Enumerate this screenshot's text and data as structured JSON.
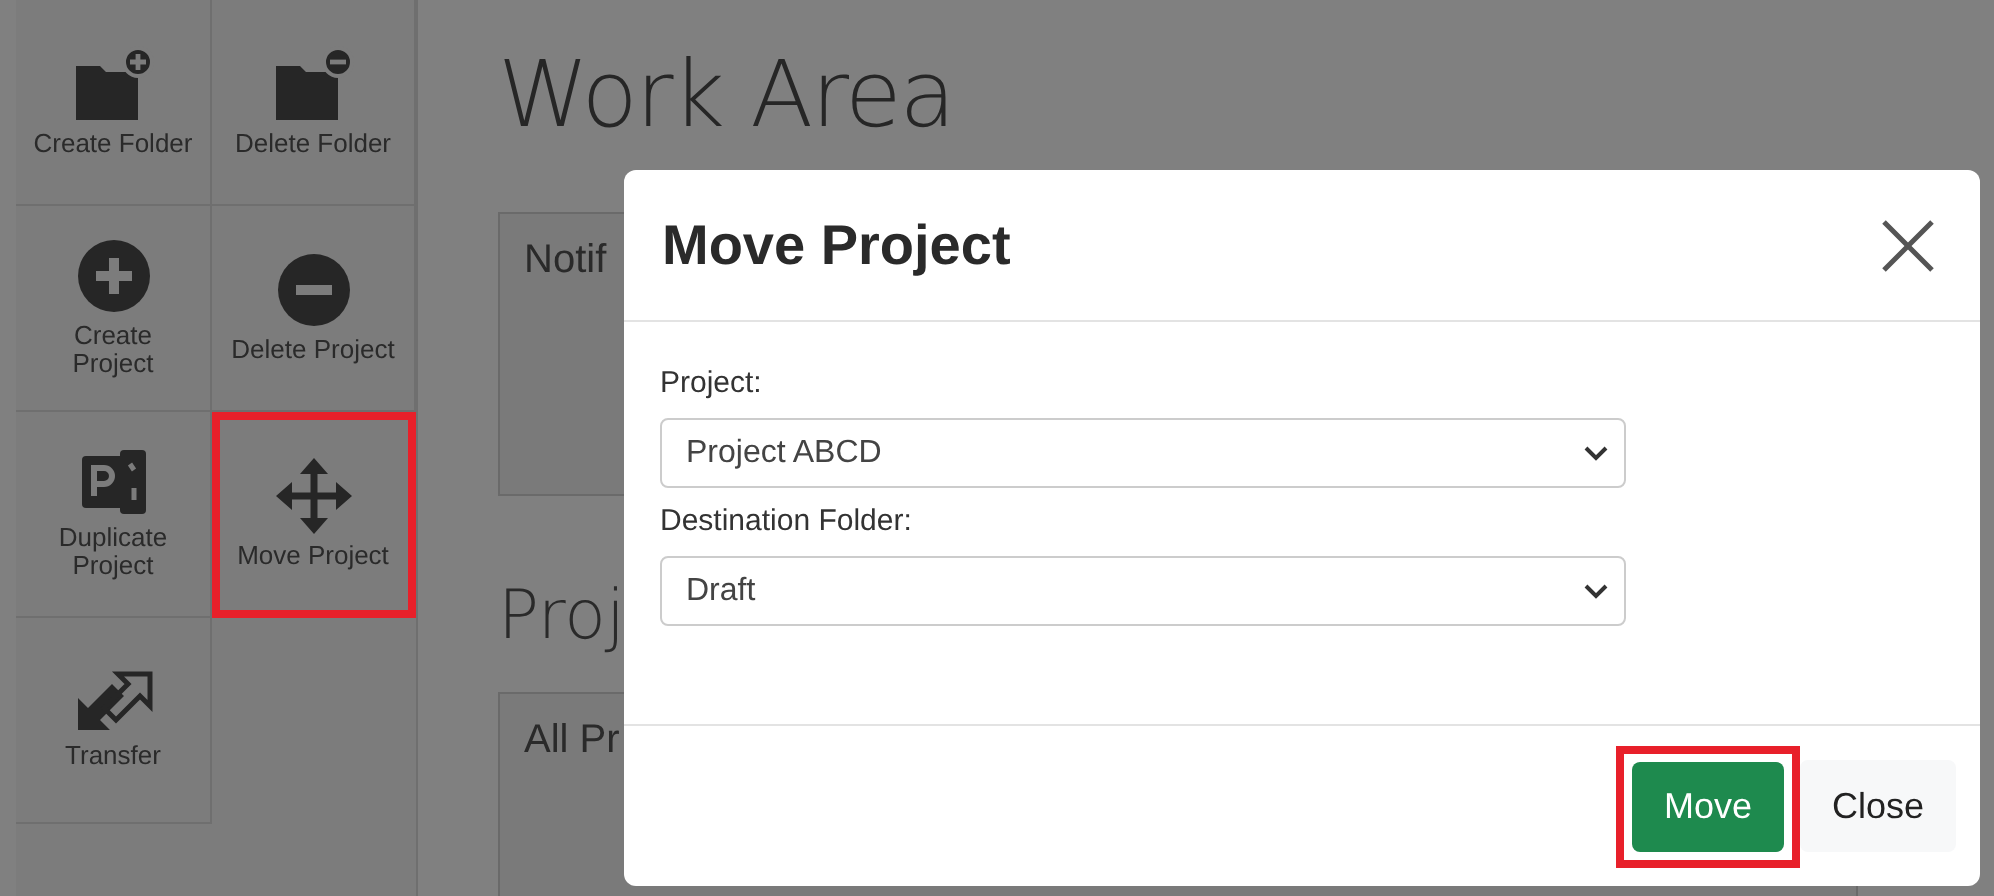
{
  "sidebar": {
    "items": [
      {
        "label": "Create Folder",
        "highlighted": false
      },
      {
        "label": "Delete Folder",
        "highlighted": false
      },
      {
        "label": "Create Project",
        "highlighted": false
      },
      {
        "label": "Delete Project",
        "highlighted": false
      },
      {
        "label": "Duplicate Project",
        "highlighted": false
      },
      {
        "label": "Move Project",
        "highlighted": true
      },
      {
        "label": "Transfer",
        "highlighted": false
      }
    ]
  },
  "main": {
    "title": "Work Area",
    "notifications_panel": "Notif",
    "projects_heading": "Proj",
    "projects_panel": "All Pr"
  },
  "dialog": {
    "title": "Move Project",
    "fields": [
      {
        "label": "Project:",
        "value": "Project ABCD"
      },
      {
        "label": "Destination Folder:",
        "value": "Draft"
      }
    ],
    "buttons": [
      {
        "label": "Move",
        "kind": "primary",
        "highlighted": true
      },
      {
        "label": "Close",
        "kind": "secondary"
      }
    ]
  }
}
